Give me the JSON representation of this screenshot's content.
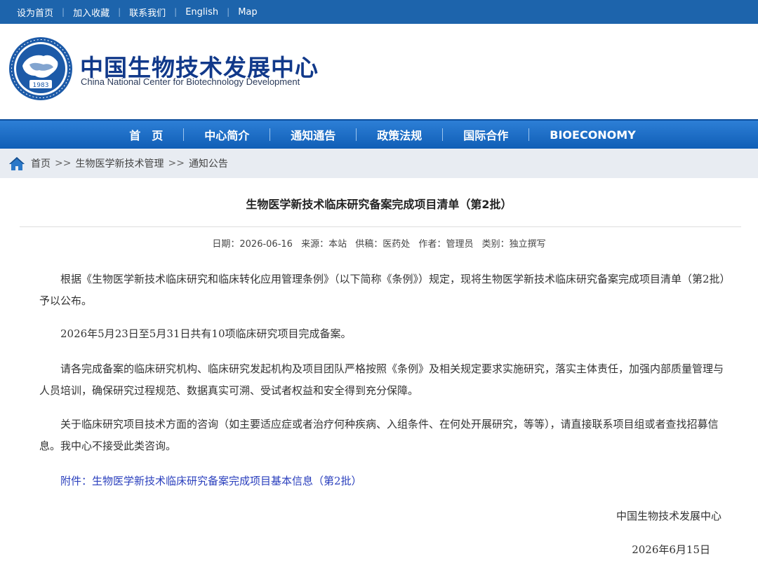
{
  "topbar": {
    "links": [
      "设为首页",
      "加入收藏",
      "联系我们",
      "English",
      "Map"
    ]
  },
  "header": {
    "logo_year": "1983",
    "name_cn": "中国生物技术发展中心",
    "name_en": "China National Center for Biotechnology Development"
  },
  "nav": {
    "items": [
      "首　页",
      "中心简介",
      "通知通告",
      "政策法规",
      "国际合作",
      "BIOECONOMY"
    ]
  },
  "breadcrumb": {
    "items": [
      "首页",
      "生物医学新技术管理",
      "通知公告"
    ],
    "separator": ">>"
  },
  "article": {
    "title": "生物医学新技术临床研究备案完成项目清单（第2批）",
    "meta": {
      "date_label": "日期：",
      "date": "2026-06-16",
      "source_label": "来源：",
      "source": "本站",
      "supplier_label": "供稿：",
      "supplier": "医药处",
      "author_label": "作者：",
      "author": "管理员",
      "type_label": "类别：",
      "type": "独立撰写"
    },
    "paragraphs": [
      "根据《生物医学新技术临床研究和临床转化应用管理条例》（以下简称《条例》）规定，现将生物医学新技术临床研究备案完成项目清单（第2批）予以公布。",
      "2026年5月23日至5月31日共有10项临床研究项目完成备案。",
      "请各完成备案的临床研究机构、临床研究发起机构及项目团队严格按照《条例》及相关规定要求实施研究，落实主体责任，加强内部质量管理与人员培训，确保研究过程规范、数据真实可溯、受试者权益和安全得到充分保障。",
      "关于临床研究项目技术方面的咨询（如主要适应症或者治疗何种疾病、入组条件、在何处开展研究，等等），请直接联系项目组或者查找招募信息。我中心不接受此类咨询。"
    ],
    "attachment_label": "附件：",
    "attachment_link": "生物医学新技术临床研究备案完成项目基本信息（第2批）",
    "signature": "中国生物技术发展中心",
    "sign_date": "2026年6月15日"
  },
  "colors": {
    "topbar": "#1d64ac",
    "nav": "#1a6fc9",
    "brand": "#11398a",
    "link": "#2a3fbd",
    "breadcrumb_bg": "#e8ecf2"
  }
}
